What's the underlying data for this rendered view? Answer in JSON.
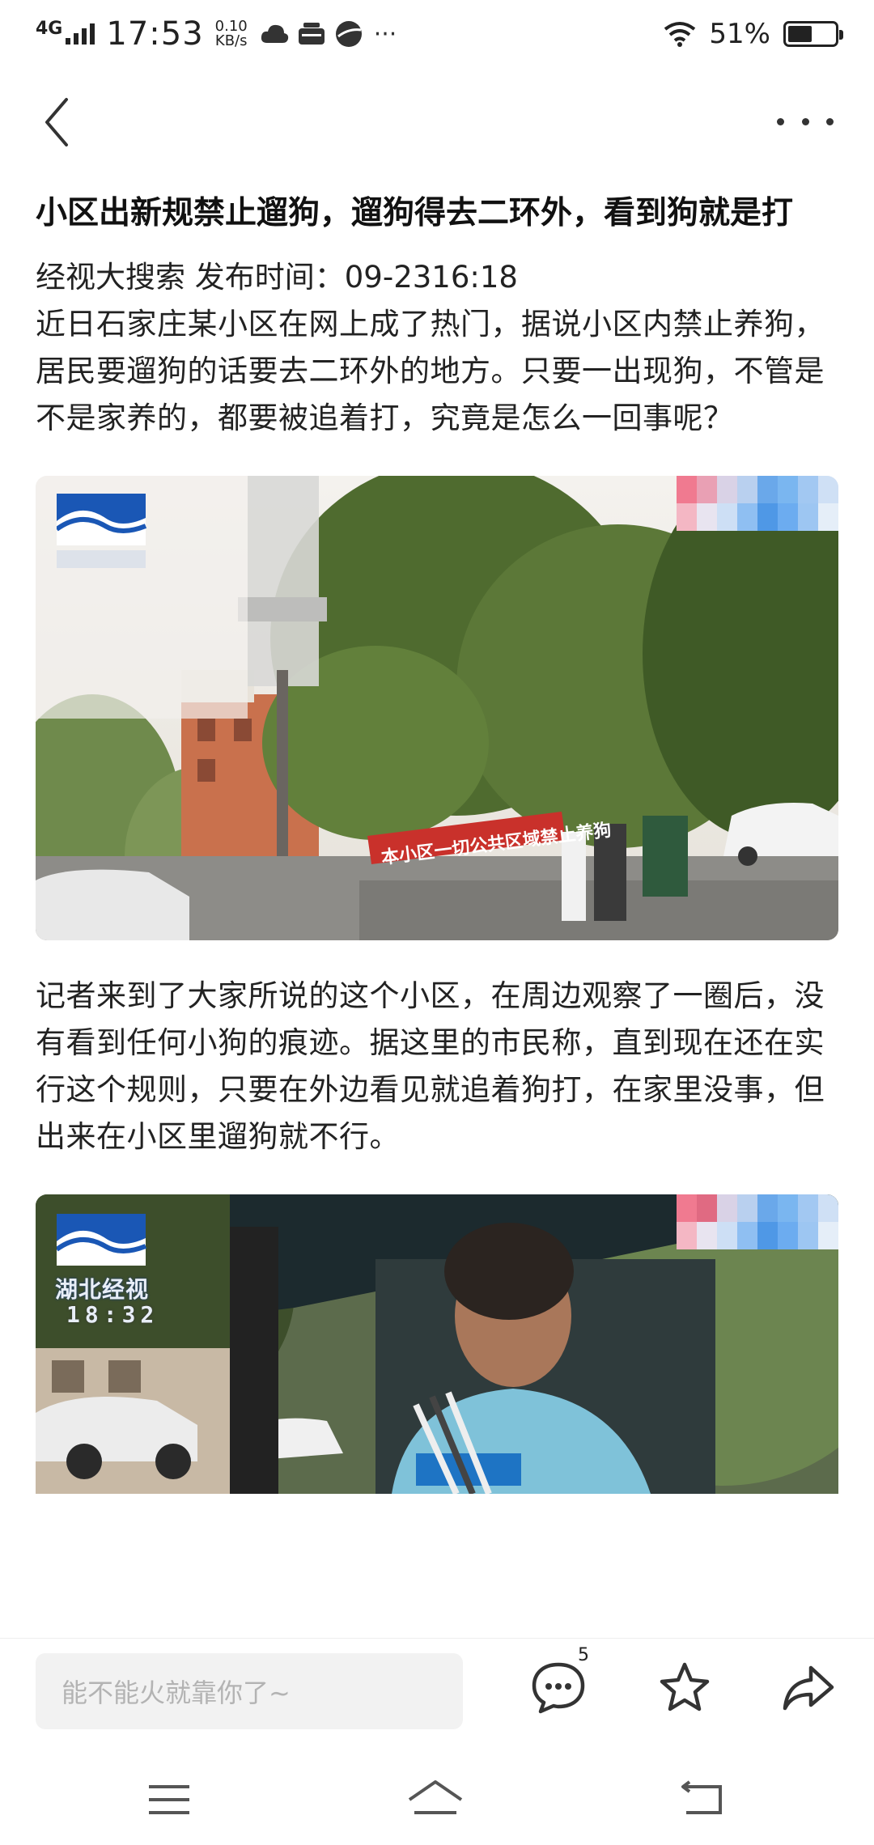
{
  "status_bar": {
    "network": "4G",
    "time": "17:53",
    "speed_value": "0.10",
    "speed_unit": "KB/s",
    "more_indicator": "···",
    "battery_percent": "51%",
    "battery_level": 0.51,
    "notification_icons": [
      "cloud-icon",
      "app-icon",
      "browser-icon"
    ]
  },
  "header": {
    "back_icon": "chevron-left-icon",
    "more_icon": "more-horizontal-icon"
  },
  "article": {
    "title": "小区出新规禁止遛狗，遛狗得去二环外，看到狗就是打",
    "meta": "经视大搜索 发布时间：09-2316:18",
    "paragraph_1": "近日石家庄某小区在网上成了热门，据说小区内禁止养狗，居民要遛狗的话要去二环外的地方。只要一出现狗，不管是不是家养的，都要被追着打，究竟是怎么一回事呢？",
    "photo_1": {
      "banner_text": "本小区一切公共区域禁止养狗"
    },
    "paragraph_2": "记者来到了大家所说的这个小区，在周边观察了一圈后，没有看到任何小狗的痕迹。据这里的市民称，直到现在还在实行这个规则，只要在外边看见就追着狗打，在家里没事，但出来在小区里遛狗就不行。",
    "photo_2": {
      "station": "湖北经视",
      "clock": "18:32"
    }
  },
  "bottom_bar": {
    "comment_placeholder": "能不能火就靠你了~",
    "comment_count": "5"
  },
  "colors": {
    "accent": "#1a57b5",
    "text": "#222222",
    "placeholder": "#b3b3b3",
    "input_bg": "#f2f2f2"
  }
}
